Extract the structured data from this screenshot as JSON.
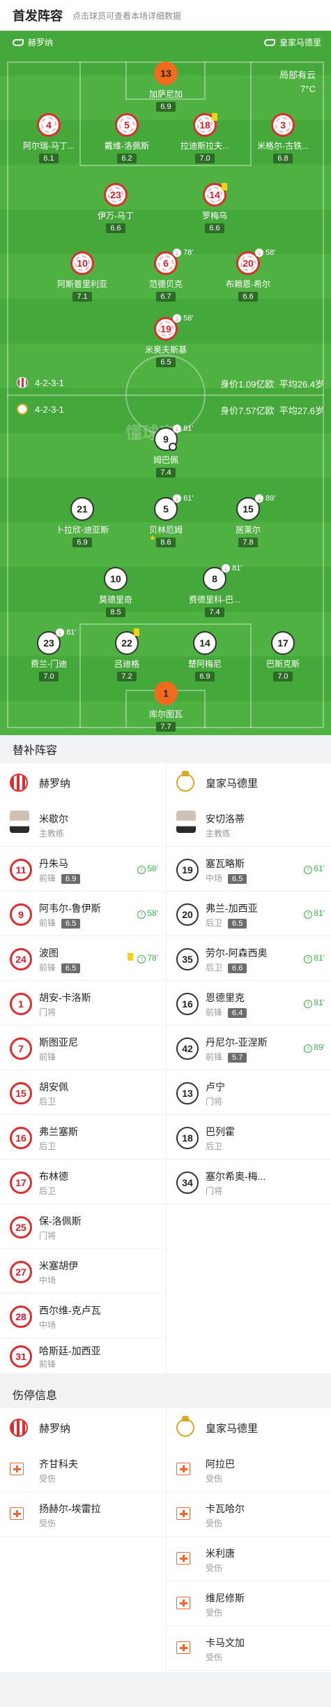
{
  "header": {
    "title": "首发阵容",
    "hint": "点击球员可查看本场详细数据"
  },
  "pitch": {
    "home_team": "赫罗纳",
    "away_team": "皇家马德里",
    "watermark": "懂球帝",
    "weather": {
      "condition": "局部有云",
      "temp": "7°C"
    },
    "home_formation": {
      "shape": "4-2-3-1",
      "value": "身价1.09亿欧",
      "age": "平均26.4岁"
    },
    "away_formation": {
      "shape": "4-2-3-1",
      "value": "身价7.57亿欧",
      "age": "平均27.6岁"
    },
    "home_players": [
      {
        "num": "13",
        "name": "加萨尼加",
        "rating": "6.9"
      },
      {
        "num": "4",
        "name": "阿尔瑞-马丁...",
        "rating": "6.1"
      },
      {
        "num": "5",
        "name": "戴维-洛佩斯",
        "rating": "6.2"
      },
      {
        "num": "18",
        "name": "拉迪斯拉夫...",
        "rating": "7.0"
      },
      {
        "num": "3",
        "name": "米格尔-古铁...",
        "rating": "6.8"
      },
      {
        "num": "23",
        "name": "伊万-马丁",
        "rating": "6.6"
      },
      {
        "num": "14",
        "name": "罗梅乌",
        "rating": "6.6"
      },
      {
        "num": "10",
        "name": "阿斯普里利亚",
        "rating": "7.1"
      },
      {
        "num": "6",
        "name": "范德贝克",
        "rating": "6.7",
        "sub": "78'"
      },
      {
        "num": "20",
        "name": "布赖恩-希尔",
        "rating": "6.6",
        "sub": "58'"
      },
      {
        "num": "19",
        "name": "米奥夫斯基",
        "rating": "6.5",
        "sub": "58'"
      }
    ],
    "away_players": [
      {
        "num": "9",
        "name": "姆巴佩",
        "rating": "7.4",
        "sub": "81'"
      },
      {
        "num": "21",
        "name": "卜拉欣-迪亚斯",
        "rating": "6.9"
      },
      {
        "num": "5",
        "name": "贝林厄姆",
        "rating": "8.6",
        "sub": "61'"
      },
      {
        "num": "15",
        "name": "居莱尔",
        "rating": "7.8",
        "sub": "89'"
      },
      {
        "num": "10",
        "name": "莫德里奇",
        "rating": "8.5"
      },
      {
        "num": "8",
        "name": "费德里科-巴...",
        "rating": "7.4",
        "sub": "81'"
      },
      {
        "num": "23",
        "name": "费兰-门迪",
        "rating": "7.0",
        "sub": "81'"
      },
      {
        "num": "22",
        "name": "吕迪格",
        "rating": "7.2"
      },
      {
        "num": "14",
        "name": "楚阿梅尼",
        "rating": "6.9"
      },
      {
        "num": "17",
        "name": "巴斯克斯",
        "rating": "7.0"
      },
      {
        "num": "1",
        "name": "库尔图瓦",
        "rating": "7.7"
      }
    ]
  },
  "subs": {
    "title": "替补阵容",
    "home_team": "赫罗纳",
    "away_team": "皇家马德里",
    "home_coach": {
      "name": "米歇尔",
      "role": "主教练"
    },
    "away_coach": {
      "name": "安切洛蒂",
      "role": "主教练"
    },
    "home": [
      {
        "num": "11",
        "name": "丹朱马",
        "pos": "前锋",
        "rating": "6.9",
        "subin": "58'"
      },
      {
        "num": "9",
        "name": "阿韦尔-鲁伊斯",
        "pos": "前锋",
        "rating": "6.5",
        "subin": "58'"
      },
      {
        "num": "24",
        "name": "波图",
        "pos": "前锋",
        "rating": "6.5",
        "subin": "78'"
      },
      {
        "num": "1",
        "name": "胡安-卡洛斯",
        "pos": "门将"
      },
      {
        "num": "7",
        "name": "斯图亚尼",
        "pos": "前锋"
      },
      {
        "num": "15",
        "name": "胡安佩",
        "pos": "后卫"
      },
      {
        "num": "16",
        "name": "弗兰塞斯",
        "pos": "后卫"
      },
      {
        "num": "17",
        "name": "布林德",
        "pos": "后卫"
      },
      {
        "num": "25",
        "name": "保-洛佩斯",
        "pos": "门将"
      },
      {
        "num": "27",
        "name": "米塞胡伊",
        "pos": "中场"
      },
      {
        "num": "28",
        "name": "西尔维-克卢瓦",
        "pos": "中场"
      },
      {
        "num": "31",
        "name": "哈斯廷-加西亚",
        "pos": "前锋"
      }
    ],
    "away": [
      {
        "num": "19",
        "name": "塞瓦略斯",
        "pos": "中场",
        "rating": "6.5",
        "subin": "61'"
      },
      {
        "num": "20",
        "name": "弗兰-加西亚",
        "pos": "后卫",
        "rating": "6.5",
        "subin": "81'"
      },
      {
        "num": "35",
        "name": "劳尔-阿森西奥",
        "pos": "后卫",
        "rating": "6.6",
        "subin": "81'"
      },
      {
        "num": "16",
        "name": "恩德里克",
        "pos": "前锋",
        "rating": "6.4",
        "subin": "81'"
      },
      {
        "num": "42",
        "name": "丹尼尔-亚涅斯",
        "pos": "前锋",
        "rating": "5.7",
        "subin": "89'"
      },
      {
        "num": "13",
        "name": "卢宁",
        "pos": "门将"
      },
      {
        "num": "18",
        "name": "巴列霍",
        "pos": "后卫"
      },
      {
        "num": "34",
        "name": "塞尔希奥-梅...",
        "pos": "门将"
      }
    ]
  },
  "injuries": {
    "title": "伤停信息",
    "home_team": "赫罗纳",
    "away_team": "皇家马德里",
    "home": [
      {
        "name": "齐甘科夫",
        "status": "受伤"
      },
      {
        "name": "扬赫尔-埃雷拉",
        "status": "受伤"
      }
    ],
    "away": [
      {
        "name": "阿拉巴",
        "status": "受伤"
      },
      {
        "name": "卡瓦哈尔",
        "status": "受伤"
      },
      {
        "name": "米利唐",
        "status": "受伤"
      },
      {
        "name": "维尼修斯",
        "status": "受伤"
      },
      {
        "name": "卡马文加",
        "status": "受伤"
      }
    ]
  }
}
